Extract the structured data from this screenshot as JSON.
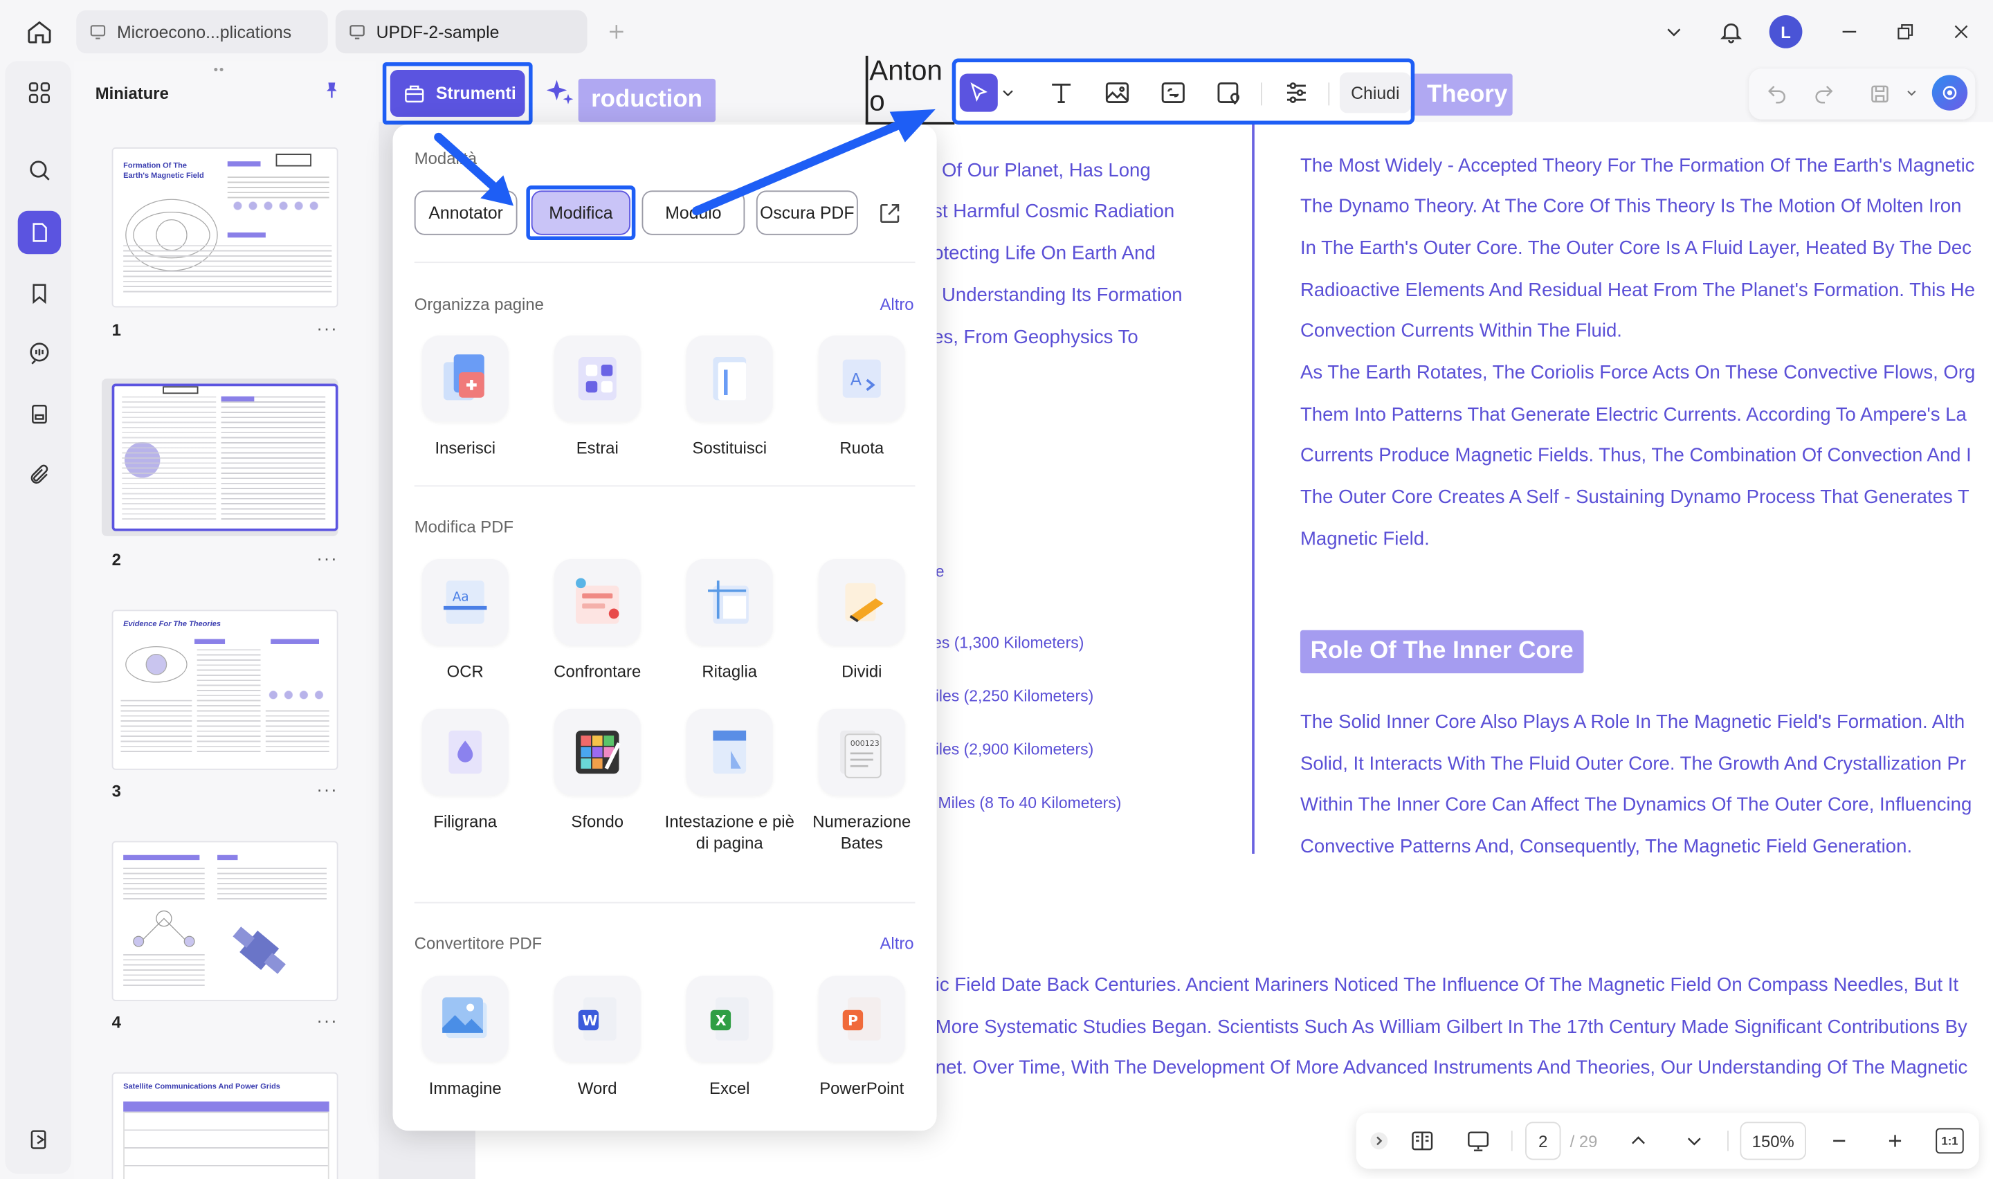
{
  "tabs": [
    {
      "label": "Microecono...plications"
    },
    {
      "label": "UPDF-2-sample"
    }
  ],
  "user": {
    "initial": "L"
  },
  "sidebar_panel": {
    "title": "Miniature"
  },
  "thumbnails": [
    {
      "num": "1",
      "heading": "Formation Of The Earth's Magnetic Field"
    },
    {
      "num": "2",
      "heading": ""
    },
    {
      "num": "3",
      "heading": "Evidence For The Theories"
    },
    {
      "num": "4",
      "heading": ""
    },
    {
      "num": "",
      "heading": "Satellite Communications And Power Grids"
    }
  ],
  "toolbar": {
    "tools_label": "Strumenti",
    "close_label": "Chiudi"
  },
  "doc": {
    "intro_badge": "roduction",
    "theory_badge": "Theory",
    "stub_text": "Anton\no",
    "left_lines": [
      "Of Our Planet, Has Long",
      "st Harmful Cosmic Radiation",
      "otecting Life On Earth And",
      "Understanding Its Formation",
      "es, From Geophysics To"
    ],
    "left_small": [
      "e",
      "es (1,300 Kilometers)",
      "iles (2,250 Kilometers)",
      "iles (2,900 Kilometers)",
      "Miles (8 To 40 Kilometers)"
    ],
    "right_lines": [
      "The Most Widely - Accepted Theory For The Formation Of The Earth's Magnetic",
      "The Dynamo Theory. At The Core Of This Theory Is The Motion Of Molten Iron",
      "In The Earth's Outer Core. The Outer Core Is A Fluid Layer, Heated By The Dec",
      "Radioactive Elements And Residual Heat From The Planet's Formation. This He",
      "Convection Currents Within The Fluid.",
      "As The Earth Rotates, The Coriolis Force Acts On These Convective Flows, Org",
      "Them Into Patterns That Generate Electric Currents. According To Ampere's La",
      "Currents Produce Magnetic Fields. Thus, The Combination Of Convection And I",
      "The Outer Core Creates A Self - Sustaining Dynamo Process That Generates T",
      "Magnetic Field."
    ],
    "inner_core_heading": "Role Of The Inner Core",
    "inner_lines": [
      "The Solid Inner Core Also Plays A Role In The Magnetic Field's Formation. Alth",
      "Solid, It Interacts With The Fluid Outer Core. The Growth And Crystallization Pr",
      "Within The Inner Core Can Affect The Dynamics Of The Outer Core, Influencing",
      "Convective Patterns And, Consequently, The Magnetic Field Generation."
    ],
    "bottom_lines": [
      "ic Field Date Back Centuries. Ancient Mariners Noticed The Influence Of The Magnetic Field On Compass Needles, But It",
      "More Systematic Studies Began. Scientists Such As William Gilbert In The 17th Century Made Significant Contributions By",
      "net. Over Time, With The Development Of More Advanced Instruments And Theories, Our Understanding Of The Magnetic"
    ]
  },
  "panel": {
    "modes_title": "Modalità",
    "modes": [
      {
        "label": "Annotator"
      },
      {
        "label": "Modifica"
      },
      {
        "label": "Modulo"
      },
      {
        "label": "Oscura PDF"
      }
    ],
    "organize": {
      "title": "Organizza pagine",
      "more": "Altro",
      "tools": [
        {
          "label": "Inserisci"
        },
        {
          "label": "Estrai"
        },
        {
          "label": "Sostituisci"
        },
        {
          "label": "Ruota"
        }
      ]
    },
    "edit": {
      "title": "Modifica PDF",
      "tools": [
        {
          "label": "OCR"
        },
        {
          "label": "Confrontare"
        },
        {
          "label": "Ritaglia"
        },
        {
          "label": "Dividi"
        },
        {
          "label": "Filigrana"
        },
        {
          "label": "Sfondo"
        },
        {
          "label": "Intestazione e piè di pagina"
        },
        {
          "label": "Numerazione Bates"
        }
      ]
    },
    "convert": {
      "title": "Convertitore PDF",
      "more": "Altro",
      "tools": [
        {
          "label": "Immagine"
        },
        {
          "label": "Word"
        },
        {
          "label": "Excel"
        },
        {
          "label": "PowerPoint"
        }
      ]
    }
  },
  "bottom_bar": {
    "page_current": "2",
    "page_total": "/ 29",
    "zoom": "150%",
    "fit_label": "1:1"
  },
  "colors": {
    "accent": "#5b54e0",
    "highlight_outline": "#1e5ef5",
    "doc_text": "#5a4fd6",
    "badge_bg": "#9a8ff0"
  }
}
